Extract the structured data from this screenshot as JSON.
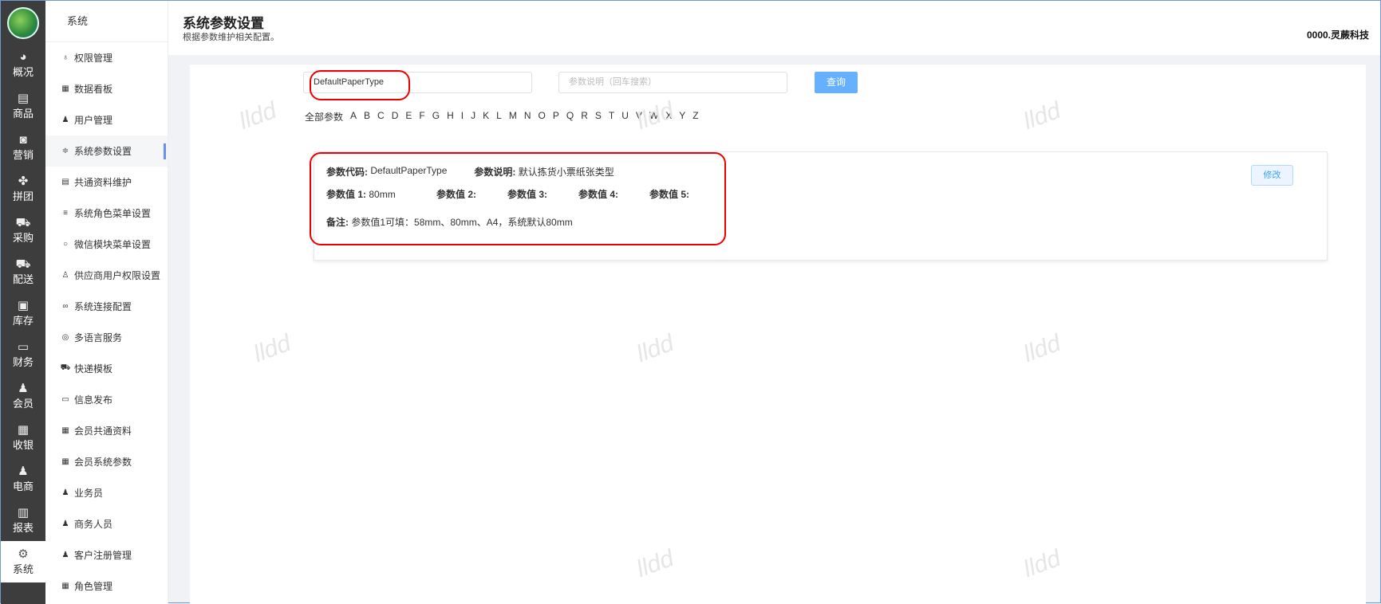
{
  "nav": {
    "items": [
      {
        "label": "概况",
        "icon": "dashboard-icon"
      },
      {
        "label": "商品",
        "icon": "document-icon"
      },
      {
        "label": "营销",
        "icon": "marketing-icon"
      },
      {
        "label": "拼团",
        "icon": "group-icon"
      },
      {
        "label": "采购",
        "icon": "cart-icon"
      },
      {
        "label": "配送",
        "icon": "truck-icon"
      },
      {
        "label": "库存",
        "icon": "box-icon"
      },
      {
        "label": "财务",
        "icon": "finance-icon"
      },
      {
        "label": "会员",
        "icon": "user-icon"
      },
      {
        "label": "收银",
        "icon": "register-icon"
      },
      {
        "label": "电商",
        "icon": "ecommerce-icon"
      },
      {
        "label": "报表",
        "icon": "report-icon"
      },
      {
        "label": "系统",
        "icon": "gear-icon"
      }
    ]
  },
  "sidebar": {
    "title": "系统",
    "items": [
      {
        "label": "权限管理",
        "icon": "key-icon"
      },
      {
        "label": "数据看板",
        "icon": "grid-icon"
      },
      {
        "label": "用户管理",
        "icon": "user-icon"
      },
      {
        "label": "系统参数设置",
        "icon": "sliders-icon"
      },
      {
        "label": "共通资料维护",
        "icon": "book-icon"
      },
      {
        "label": "系统角色菜单设置",
        "icon": "menu-icon"
      },
      {
        "label": "微信模块菜单设置",
        "icon": "chat-icon"
      },
      {
        "label": "供应商用户权限设置",
        "icon": "user-outline-icon"
      },
      {
        "label": "系统连接配置",
        "icon": "link-icon"
      },
      {
        "label": "多语言服务",
        "icon": "language-icon"
      },
      {
        "label": "快递模板",
        "icon": "truck-icon"
      },
      {
        "label": "信息发布",
        "icon": "message-icon"
      },
      {
        "label": "会员共通资料",
        "icon": "grid-icon"
      },
      {
        "label": "会员系统参数",
        "icon": "grid-icon"
      },
      {
        "label": "业务员",
        "icon": "user-icon"
      },
      {
        "label": "商务人员",
        "icon": "user-icon"
      },
      {
        "label": "客户注册管理",
        "icon": "users-icon"
      },
      {
        "label": "角色管理",
        "icon": "grid-icon"
      }
    ]
  },
  "header": {
    "title": "系统参数设置",
    "subtitle": "根据参数维护相关配置。",
    "company": "0000.灵蕨科技"
  },
  "search": {
    "code_value": "DefaultPaperType",
    "desc_placeholder": "参数说明（回车搜索）",
    "query_label": "查询"
  },
  "letters": [
    "全部参数",
    "A",
    "B",
    "C",
    "D",
    "E",
    "F",
    "G",
    "H",
    "I",
    "J",
    "K",
    "L",
    "M",
    "N",
    "O",
    "P",
    "Q",
    "R",
    "S",
    "T",
    "U",
    "V",
    "W",
    "X",
    "Y",
    "Z"
  ],
  "card": {
    "code_label": "参数代码:",
    "code": "DefaultPaperType",
    "desc_label": "参数说明:",
    "desc": "默认拣货小票纸张类型",
    "values": [
      {
        "label": "参数值 1:",
        "value": "80mm"
      },
      {
        "label": "参数值 2:",
        "value": ""
      },
      {
        "label": "参数值 3:",
        "value": ""
      },
      {
        "label": "参数值 4:",
        "value": ""
      },
      {
        "label": "参数值 5:",
        "value": ""
      }
    ],
    "note_label": "备注:",
    "note": "参数值1可填：58mm、80mm、A4，系统默认80mm",
    "modify_label": "修改"
  },
  "watermark": "lldd"
}
